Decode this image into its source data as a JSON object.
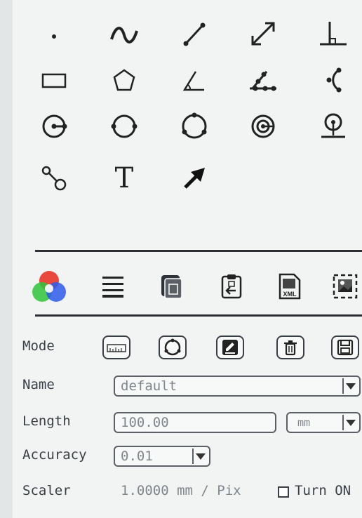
{
  "tools": [
    {
      "name": "point-tool-icon"
    },
    {
      "name": "curve-tool-icon"
    },
    {
      "name": "line-tool-icon"
    },
    {
      "name": "dimension-line-tool-icon"
    },
    {
      "name": "perpendicular-tool-icon"
    },
    {
      "name": "rectangle-tool-icon"
    },
    {
      "name": "polygon-tool-icon"
    },
    {
      "name": "angle-tool-icon"
    },
    {
      "name": "multi-point-angle-tool-icon"
    },
    {
      "name": "arc-tool-icon"
    },
    {
      "name": "circle-center-radius-tool-icon"
    },
    {
      "name": "circle-diameter-tool-icon"
    },
    {
      "name": "circle-three-point-tool-icon"
    },
    {
      "name": "concentric-circle-tool-icon"
    },
    {
      "name": "circle-tangent-line-tool-icon"
    },
    {
      "name": "two-circle-distance-tool-icon"
    },
    {
      "name": "text-tool-icon",
      "text": "T"
    },
    {
      "name": "arrow-tool-icon"
    }
  ],
  "toolbar": {
    "icons": [
      "color-wheel-icon",
      "line-width-icon",
      "copy-to-clipboard-icon",
      "paste-icon",
      "export-xml-icon",
      "screenshot-region-icon"
    ]
  },
  "mode": {
    "label": "Mode"
  },
  "name": {
    "label": "Name",
    "value": "default"
  },
  "length": {
    "label": "Length",
    "value": "100.00",
    "unit": "mm"
  },
  "accuracy": {
    "label": "Accuracy",
    "value": "0.01"
  },
  "scaler": {
    "label": "Scaler",
    "value": "1.0000 mm / Pix",
    "toggle_label": "Turn ON"
  }
}
